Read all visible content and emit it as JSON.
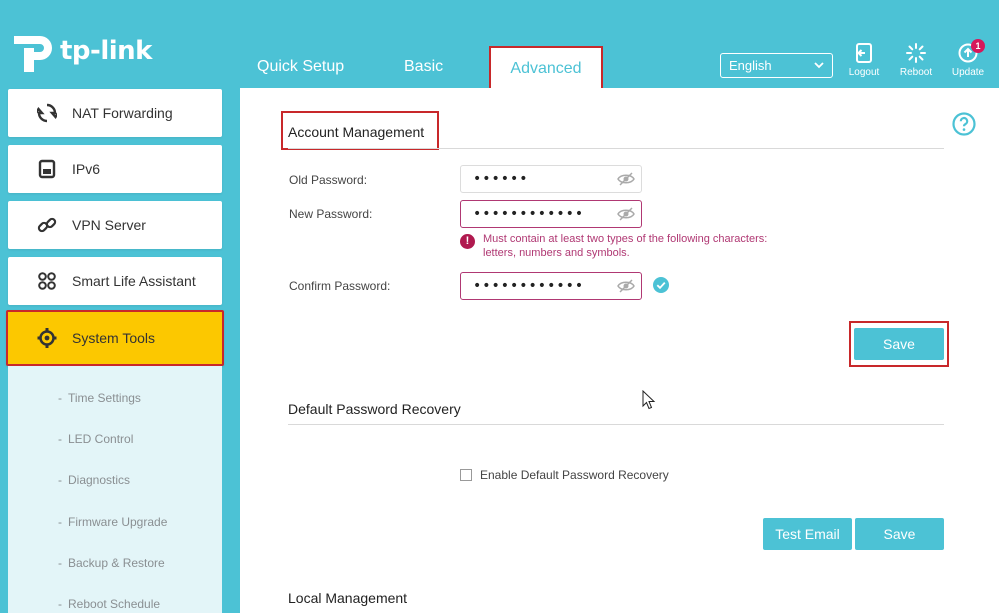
{
  "brand": {
    "name": "tp-link"
  },
  "nav": {
    "tabs": [
      "Quick Setup",
      "Basic",
      "Advanced"
    ],
    "active": "Advanced"
  },
  "language": {
    "selected": "English"
  },
  "tools": {
    "logout": "Logout",
    "reboot": "Reboot",
    "update": "Update",
    "update_badge": "1"
  },
  "sidebar": {
    "items": [
      {
        "label": "NAT Forwarding",
        "icon": "nat-forwarding-icon"
      },
      {
        "label": "IPv6",
        "icon": "ipv6-icon"
      },
      {
        "label": "VPN Server",
        "icon": "vpn-link-icon"
      },
      {
        "label": "Smart Life Assistant",
        "icon": "smart-life-icon"
      },
      {
        "label": "System Tools",
        "icon": "gear-icon",
        "active": true
      }
    ],
    "submenu": [
      "Time Settings",
      "LED Control",
      "Diagnostics",
      "Firmware Upgrade",
      "Backup & Restore",
      "Reboot Schedule"
    ]
  },
  "account": {
    "title": "Account Management",
    "old_label": "Old Password:",
    "old_value": "••••••",
    "new_label": "New Password:",
    "new_value": "••••••••••••",
    "error_line1": "Must contain at least two types of the following characters:",
    "error_line2": "letters, numbers and symbols.",
    "confirm_label": "Confirm Password:",
    "confirm_value": "••••••••••••",
    "save": "Save"
  },
  "recovery": {
    "title": "Default Password Recovery",
    "checkbox_label": "Enable Default Password Recovery",
    "test_email": "Test Email",
    "save": "Save"
  },
  "local": {
    "title": "Local Management"
  },
  "colors": {
    "accent": "#4cc2d5",
    "highlight": "#fcc800",
    "annotation": "#c8282a",
    "error": "#b03873"
  }
}
